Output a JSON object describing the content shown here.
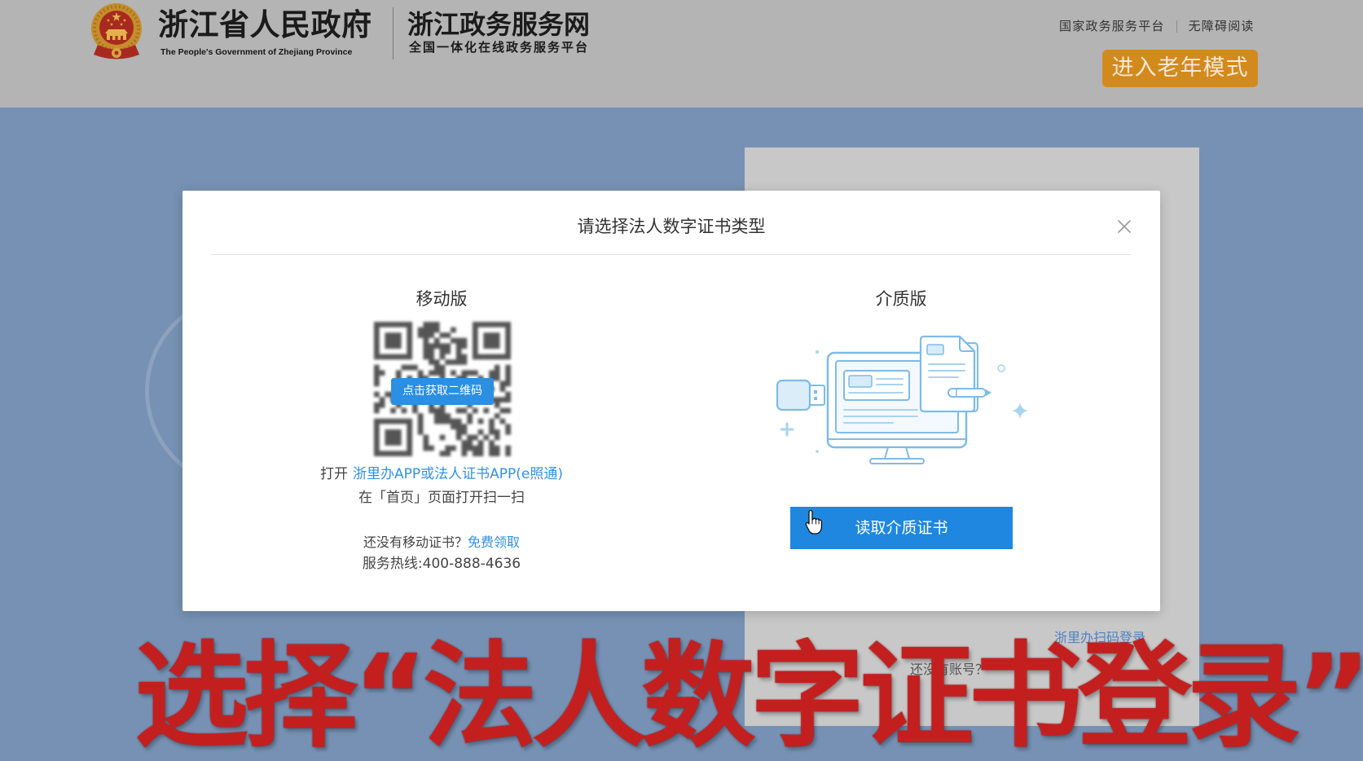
{
  "header": {
    "emblem_icon": "national-emblem-icon",
    "site_title": "浙江省人民政府",
    "site_subtitle_en": "The People's Government of Zhejiang Province",
    "portal_title": "浙江政务服务网",
    "portal_subtitle": "全国一体化在线政务服务平台",
    "top_links": [
      "国家政务服务平台",
      "无障碍阅读"
    ],
    "elder_mode_button": "进入老年模式"
  },
  "login_panel": {
    "scan_login_link": "浙里办扫码登录",
    "no_account_text": "还没有账号？"
  },
  "modal": {
    "title": "请选择法人数字证书类型",
    "close_icon": "close-icon",
    "mobile": {
      "heading": "移动版",
      "qr_icon": "qr-code-icon",
      "qr_button": "点击获取二维码",
      "open_prefix": "打开",
      "app_link": "浙里办APP或法人证书APP(e照通)",
      "scan_hint": "在「首页」页面打开扫一扫",
      "no_cert_text": "还没有移动证书？",
      "free_claim_link": "免费领取",
      "hotline": "服务热线:400-888-4636"
    },
    "medium": {
      "heading": "介质版",
      "illustration_icon": "computer-usb-key-certificate-illustration",
      "read_button": "读取介质证书"
    }
  },
  "caption": "选择“法人数字证书登录”",
  "cursor_icon": "hand-pointer-icon",
  "colors": {
    "page_background": "#7691b3",
    "header_background": "#b4b4b4",
    "elder_button": "#d38a1d",
    "primary_blue": "#1f87df",
    "link_blue": "#3390e3",
    "caption_red": "#c41f1f"
  }
}
